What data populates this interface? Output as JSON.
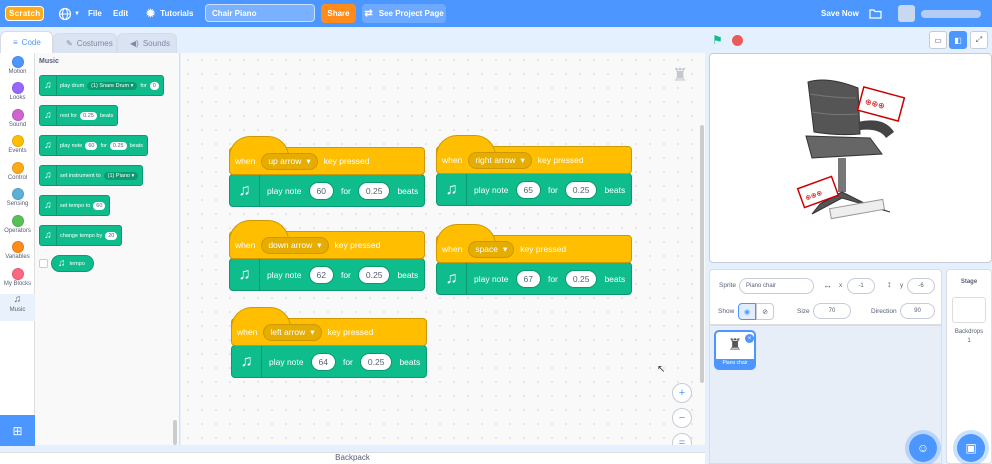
{
  "menu": {
    "logo": "Scratch",
    "file": "File",
    "edit": "Edit",
    "tutorials": "Tutorials",
    "project_title": "Chair Piano",
    "share": "Share",
    "see_project": "See Project Page",
    "save_now": "Save Now"
  },
  "tabs": {
    "code": "Code",
    "costumes": "Costumes",
    "sounds": "Sounds"
  },
  "categories": [
    {
      "label": "Motion",
      "color": "#4c97ff"
    },
    {
      "label": "Looks",
      "color": "#9966ff"
    },
    {
      "label": "Sound",
      "color": "#cf63cf"
    },
    {
      "label": "Events",
      "color": "#ffbf00"
    },
    {
      "label": "Control",
      "color": "#ffab19"
    },
    {
      "label": "Sensing",
      "color": "#5cb1d6"
    },
    {
      "label": "Operators",
      "color": "#59c059"
    },
    {
      "label": "Variables",
      "color": "#ff8c1a"
    },
    {
      "label": "My Blocks",
      "color": "#ff6680"
    },
    {
      "label": "Music",
      "color": "#0fbd8c"
    }
  ],
  "palette": {
    "title": "Music",
    "play_drum": "play drum",
    "drum_value": "(1) Snare Drum",
    "drum_for": "for",
    "drum_beats_value": "0",
    "rest_for": "rest for",
    "rest_value": "0.25",
    "rest_beats": "beats",
    "play_note": "play note",
    "note_value": "60",
    "note_for": "for",
    "note_beats_value": "0.25",
    "note_beats": "beats",
    "set_instrument": "set instrument to",
    "instrument_value": "(1) Piano",
    "set_tempo": "set tempo to",
    "tempo_value": "60",
    "change_tempo": "change tempo by",
    "change_tempo_value": "20",
    "tempo_reporter": "tempo"
  },
  "scripts": [
    {
      "when": "when",
      "key": "up arrow",
      "pressed": "key pressed",
      "play": "play note",
      "note": "60",
      "for": "for",
      "beats_value": "0.25",
      "beats": "beats"
    },
    {
      "when": "when",
      "key": "right arrow",
      "pressed": "key pressed",
      "play": "play note",
      "note": "65",
      "for": "for",
      "beats_value": "0.25",
      "beats": "beats"
    },
    {
      "when": "when",
      "key": "down arrow",
      "pressed": "key pressed",
      "play": "play note",
      "note": "62",
      "for": "for",
      "beats_value": "0.25",
      "beats": "beats"
    },
    {
      "when": "when",
      "key": "space",
      "pressed": "key pressed",
      "play": "play note",
      "note": "67",
      "for": "for",
      "beats_value": "0.25",
      "beats": "beats"
    },
    {
      "when": "when",
      "key": "left arrow",
      "pressed": "key pressed",
      "play": "play note",
      "note": "64",
      "for": "for",
      "beats_value": "0.25",
      "beats": "beats"
    }
  ],
  "zoom": {
    "in": "+",
    "out": "−",
    "reset": "="
  },
  "backpack": "Backpack",
  "sprite_info": {
    "sprite_label": "Sprite",
    "sprite_name": "Piano chair",
    "x_label": "x",
    "x_value": "-1",
    "y_label": "y",
    "y_value": "-6",
    "show_label": "Show",
    "size_label": "Size",
    "size_value": "70",
    "direction_label": "Direction",
    "direction_value": "90"
  },
  "sprite_tile": {
    "name": "Piano chair"
  },
  "stage_pane": {
    "title": "Stage",
    "backdrops_label": "Backdrops",
    "backdrops_count": "1"
  }
}
